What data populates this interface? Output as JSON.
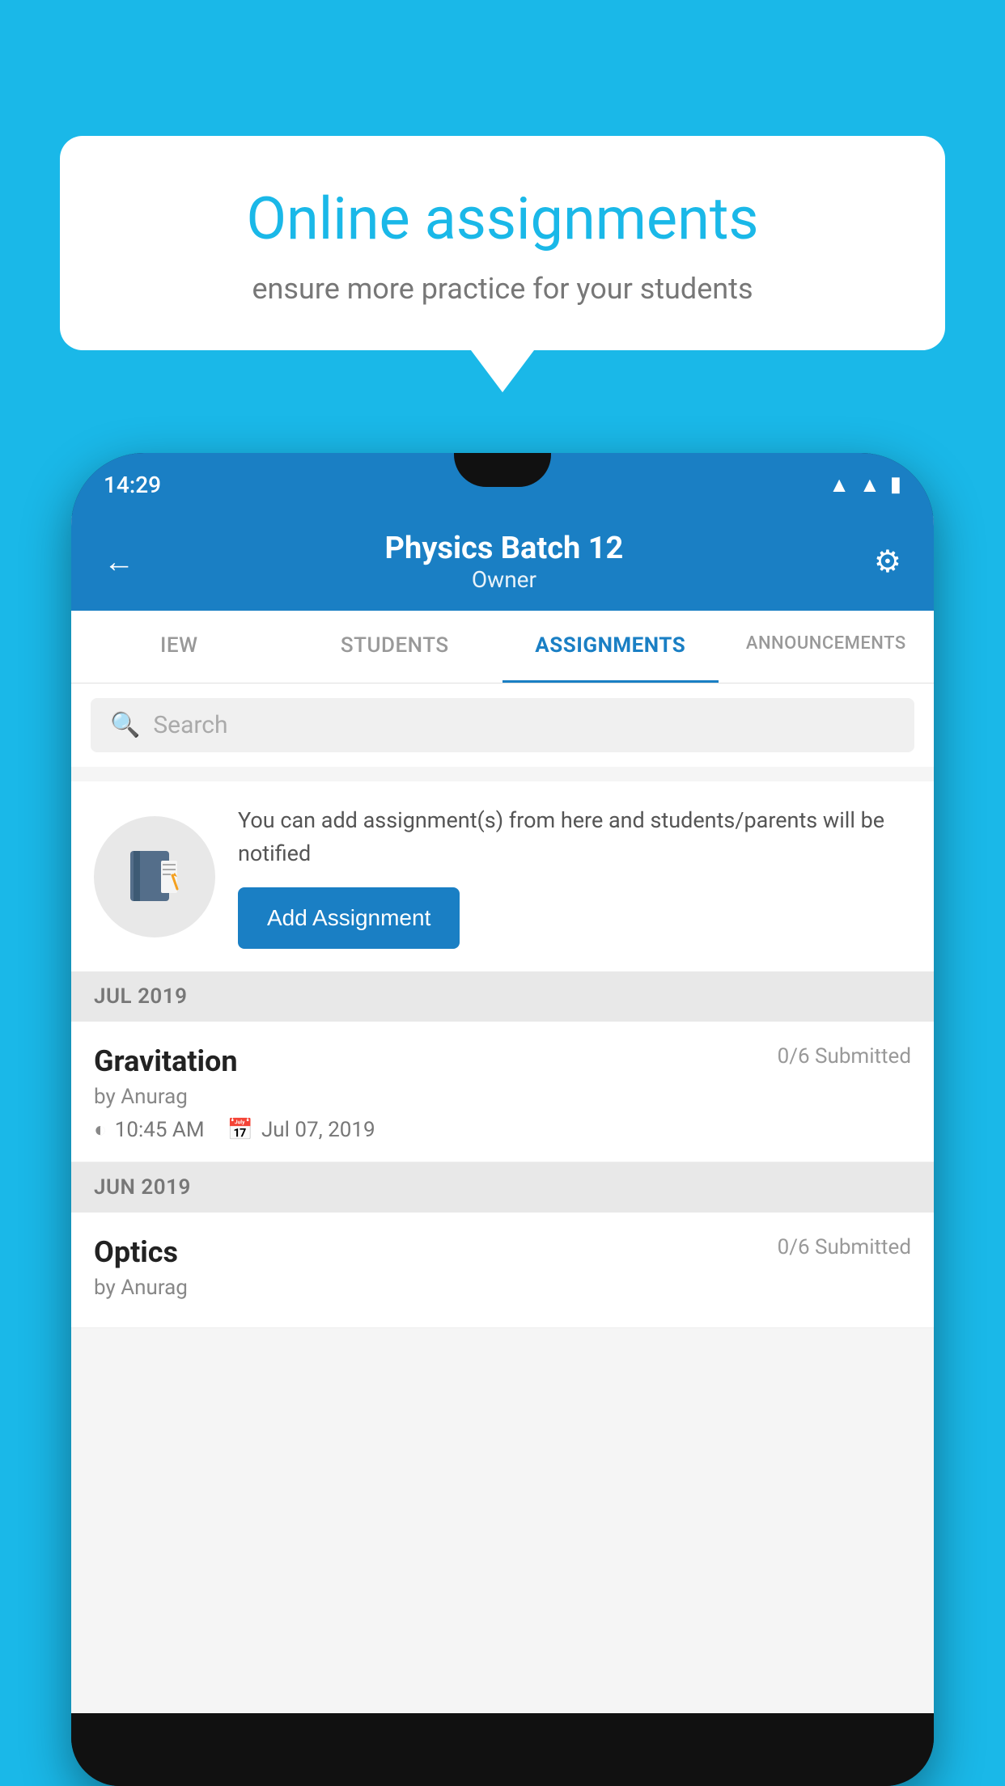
{
  "background_color": "#1ab8e8",
  "bubble": {
    "title": "Online assignments",
    "subtitle": "ensure more practice for your students"
  },
  "phone": {
    "status_bar": {
      "time": "14:29"
    },
    "header": {
      "title": "Physics Batch 12",
      "subtitle": "Owner"
    },
    "tabs": [
      {
        "label": "IEW",
        "active": false
      },
      {
        "label": "STUDENTS",
        "active": false
      },
      {
        "label": "ASSIGNMENTS",
        "active": true
      },
      {
        "label": "ANNOUNCEMENTS",
        "active": false
      }
    ],
    "search": {
      "placeholder": "Search"
    },
    "info_card": {
      "description": "You can add assignment(s) from here and students/parents will be notified",
      "button_label": "Add Assignment"
    },
    "sections": [
      {
        "month": "JUL 2019",
        "assignments": [
          {
            "name": "Gravitation",
            "submitted": "0/6 Submitted",
            "by": "by Anurag",
            "time": "10:45 AM",
            "date": "Jul 07, 2019"
          }
        ]
      },
      {
        "month": "JUN 2019",
        "assignments": [
          {
            "name": "Optics",
            "submitted": "0/6 Submitted",
            "by": "by Anurag",
            "time": "",
            "date": ""
          }
        ]
      }
    ]
  }
}
